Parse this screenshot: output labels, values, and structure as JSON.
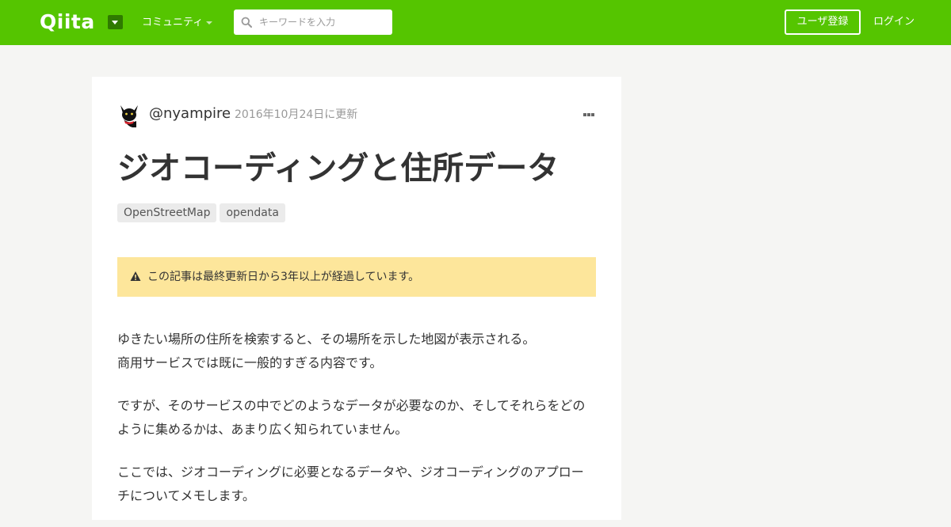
{
  "header": {
    "logo": "Qiita",
    "community": "コミュニティ",
    "search_placeholder": "キーワードを入力",
    "signup": "ユーザ登録",
    "login": "ログイン"
  },
  "article": {
    "username": "@nyampire",
    "updated": "2016年10月24日に更新",
    "title": "ジオコーディングと住所データ",
    "tags": [
      "OpenStreetMap",
      "opendata"
    ],
    "alert": "この記事は最終更新日から3年以上が経過しています。",
    "paragraphs": [
      [
        "ゆきたい場所の住所を検索すると、その場所を示した地図が表示される。",
        "商用サービスでは既に一般的すぎる内容です。"
      ],
      [
        "ですが、そのサービスの中でどのようなデータが必要なのか、そしてそれらをどの",
        "ように集めるかは、あまり広く知られていません。"
      ],
      [
        "ここでは、ジオコーディングに必要となるデータや、ジオコーディングのアプロー",
        "チについてメモします。"
      ]
    ]
  },
  "colors": {
    "brand": "#55c500",
    "alert_bg": "#fde69b"
  }
}
